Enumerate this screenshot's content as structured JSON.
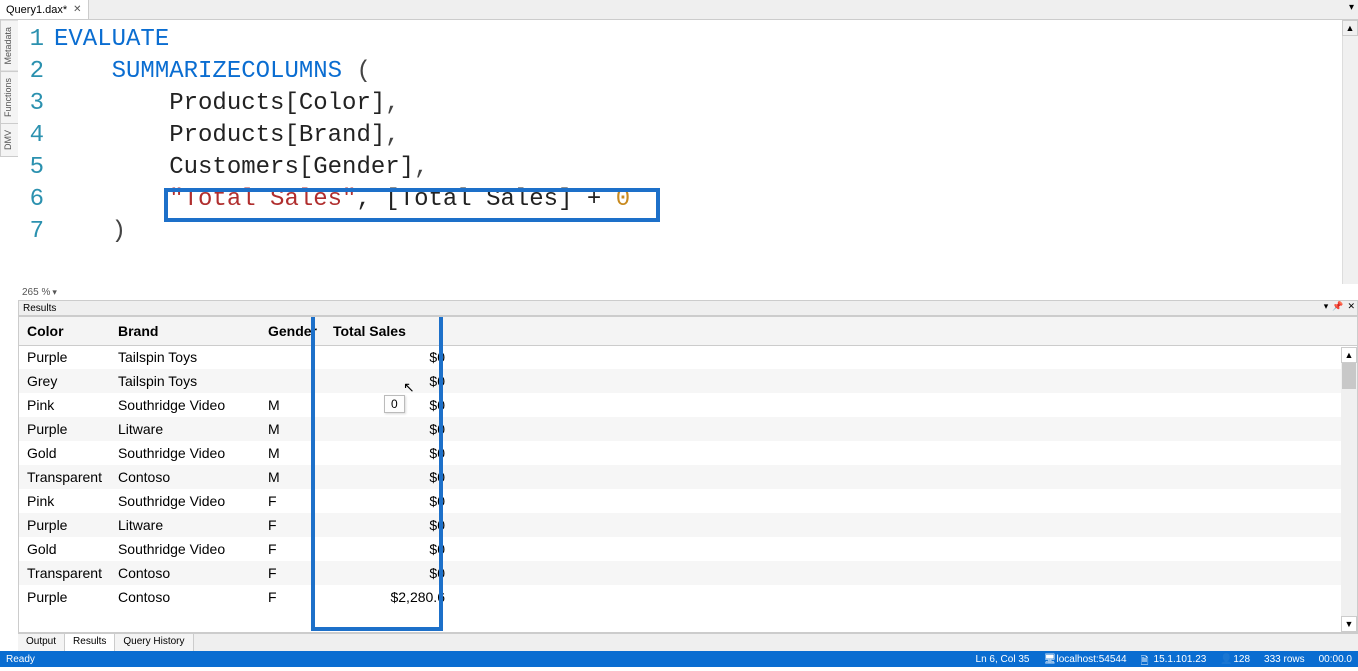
{
  "tabs": {
    "file_name": "Query1.dax*",
    "close_glyph": "✕"
  },
  "side_tabs": [
    "Metadata",
    "Functions",
    "DMV"
  ],
  "editor": {
    "zoom": "265 %",
    "lines": [
      {
        "n": "1",
        "tokens": [
          {
            "t": "EVALUATE",
            "c": "kw"
          }
        ]
      },
      {
        "n": "2",
        "tokens": [
          {
            "t": "    ",
            "c": "punct"
          },
          {
            "t": "SUMMARIZECOLUMNS",
            "c": "kw"
          },
          {
            "t": " (",
            "c": "punct"
          }
        ]
      },
      {
        "n": "3",
        "tokens": [
          {
            "t": "        Products[Color]",
            "c": "ident"
          },
          {
            "t": ",",
            "c": "punct"
          }
        ]
      },
      {
        "n": "4",
        "tokens": [
          {
            "t": "        Products[Brand]",
            "c": "ident"
          },
          {
            "t": ",",
            "c": "punct"
          }
        ]
      },
      {
        "n": "5",
        "tokens": [
          {
            "t": "        Customers[Gender]",
            "c": "ident"
          },
          {
            "t": ",",
            "c": "punct"
          }
        ]
      },
      {
        "n": "6",
        "tokens": [
          {
            "t": "        ",
            "c": "punct"
          },
          {
            "t": "\"Total Sales\"",
            "c": "str"
          },
          {
            "t": ", [Total Sales] + ",
            "c": "ident"
          },
          {
            "t": "0",
            "c": "num"
          }
        ]
      },
      {
        "n": "7",
        "tokens": [
          {
            "t": "    )",
            "c": "punct"
          }
        ]
      }
    ]
  },
  "results": {
    "panel_title": "Results",
    "tooltip_value": "0",
    "columns": [
      "Color",
      "Brand",
      "Gender",
      "Total Sales"
    ],
    "rows": [
      {
        "color": "Purple",
        "brand": "Tailspin Toys",
        "gender": "",
        "sales": "$0"
      },
      {
        "color": "Grey",
        "brand": "Tailspin Toys",
        "gender": "",
        "sales": "$0"
      },
      {
        "color": "Pink",
        "brand": "Southridge Video",
        "gender": "M",
        "sales": "$0"
      },
      {
        "color": "Purple",
        "brand": "Litware",
        "gender": "M",
        "sales": "$0"
      },
      {
        "color": "Gold",
        "brand": "Southridge Video",
        "gender": "M",
        "sales": "$0"
      },
      {
        "color": "Transparent",
        "brand": "Contoso",
        "gender": "M",
        "sales": "$0"
      },
      {
        "color": "Pink",
        "brand": "Southridge Video",
        "gender": "F",
        "sales": "$0"
      },
      {
        "color": "Purple",
        "brand": "Litware",
        "gender": "F",
        "sales": "$0"
      },
      {
        "color": "Gold",
        "brand": "Southridge Video",
        "gender": "F",
        "sales": "$0"
      },
      {
        "color": "Transparent",
        "brand": "Contoso",
        "gender": "F",
        "sales": "$0"
      },
      {
        "color": "Purple",
        "brand": "Contoso",
        "gender": "F",
        "sales": "$2,280.6"
      }
    ]
  },
  "bottom_tabs": {
    "output": "Output",
    "results": "Results",
    "history": "Query History"
  },
  "status": {
    "ready": "Ready",
    "pos": "Ln 6, Col 35",
    "server": "localhost:54544",
    "version": "15.1.101.23",
    "users": "128",
    "rows": "333 rows",
    "time": "00:00.0"
  }
}
